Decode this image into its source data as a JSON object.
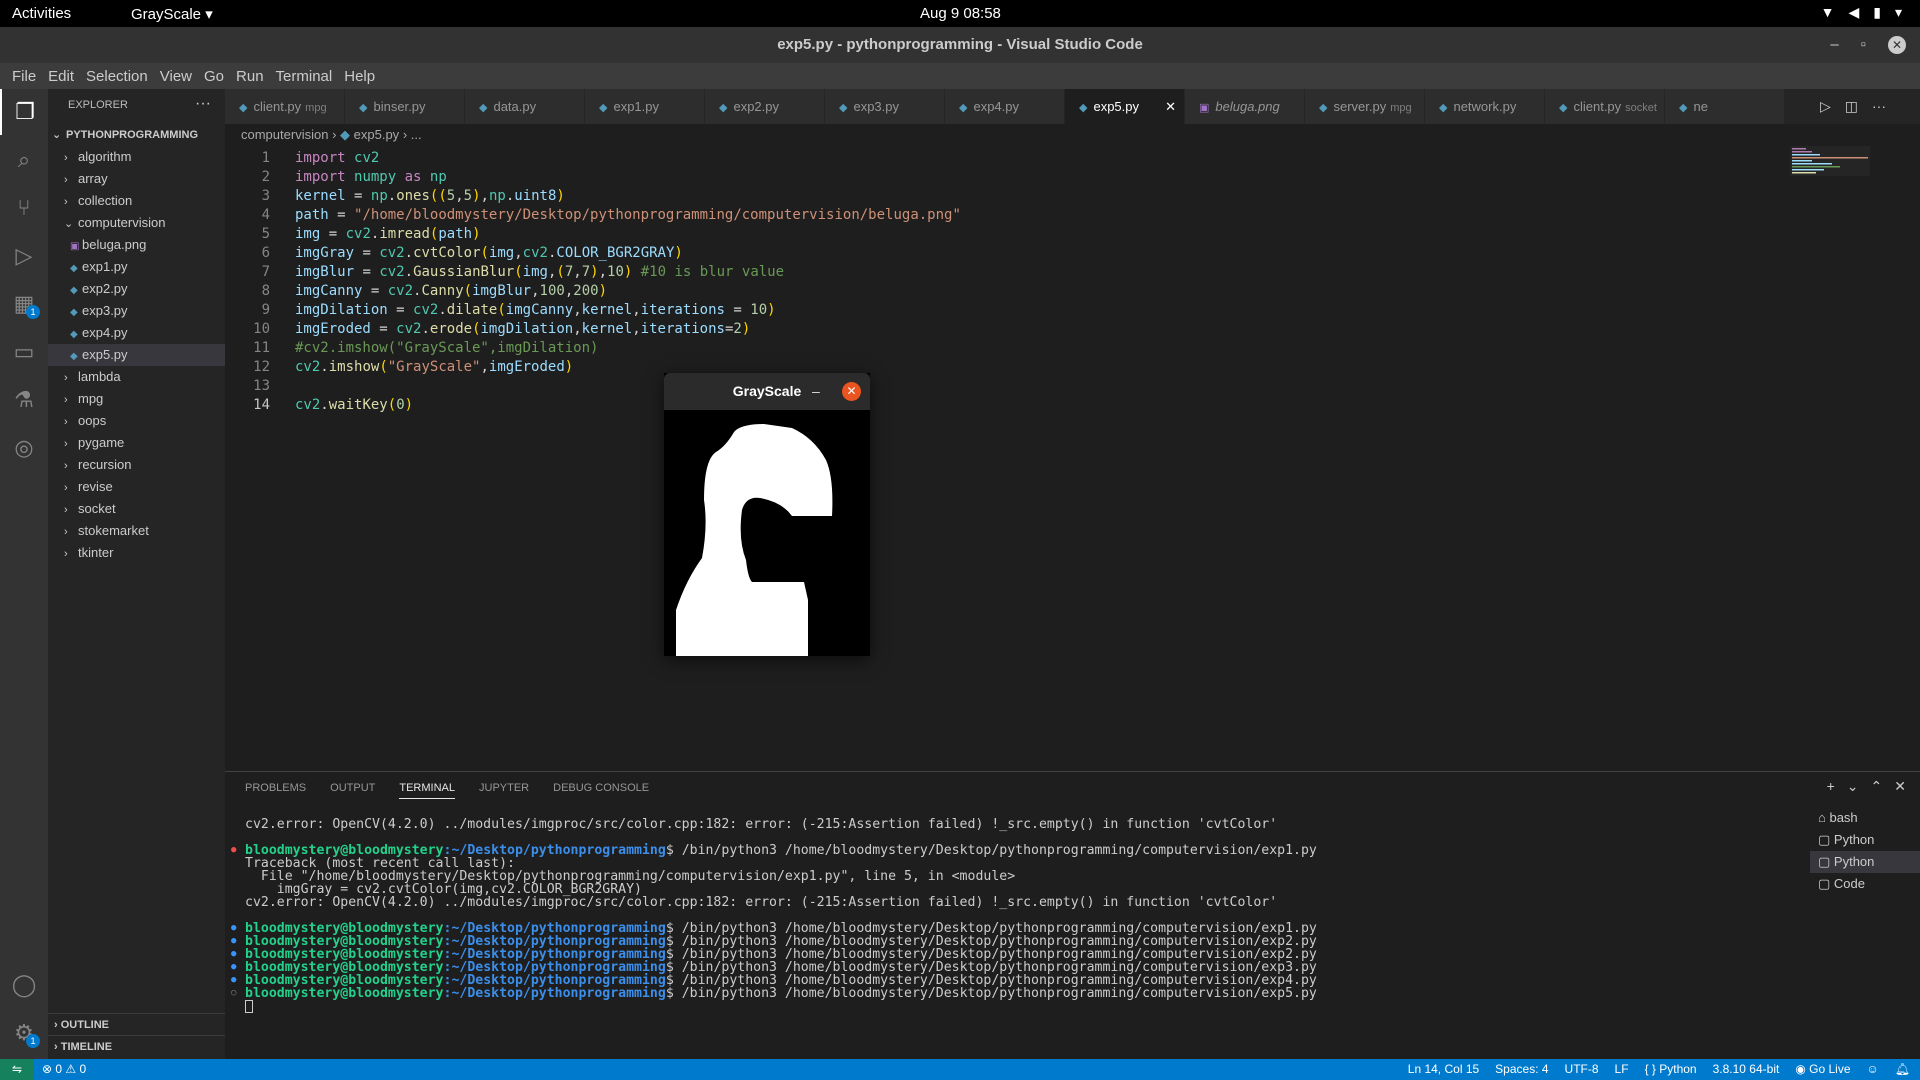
{
  "topbar": {
    "activities": "Activities",
    "app_menu": "GrayScale ▾",
    "clock": "Aug 9  08:58"
  },
  "window": {
    "title": "exp5.py - pythonprogramming - Visual Studio Code"
  },
  "menu": [
    "File",
    "Edit",
    "Selection",
    "View",
    "Go",
    "Run",
    "Terminal",
    "Help"
  ],
  "activity_bar": {
    "icons": [
      "explorer-icon",
      "search-icon",
      "source-control-icon",
      "run-debug-icon",
      "extensions-icon",
      "remote-explorer-icon",
      "testing-icon",
      "jupyter-icon",
      "account-icon",
      "settings-gear-icon"
    ],
    "extensions_badge": "1",
    "settings_badge": "1"
  },
  "explorer": {
    "header": "EXPLORER",
    "root": "PYTHONPROGRAMMING",
    "items": [
      {
        "label": "algorithm",
        "type": "folder"
      },
      {
        "label": "array",
        "type": "folder"
      },
      {
        "label": "collection",
        "type": "folder"
      },
      {
        "label": "computervision",
        "type": "folder-open"
      },
      {
        "label": "beluga.png",
        "type": "image"
      },
      {
        "label": "exp1.py",
        "type": "py"
      },
      {
        "label": "exp2.py",
        "type": "py"
      },
      {
        "label": "exp3.py",
        "type": "py"
      },
      {
        "label": "exp4.py",
        "type": "py"
      },
      {
        "label": "exp5.py",
        "type": "py",
        "selected": true
      },
      {
        "label": "lambda",
        "type": "folder"
      },
      {
        "label": "mpg",
        "type": "folder"
      },
      {
        "label": "oops",
        "type": "folder"
      },
      {
        "label": "pygame",
        "type": "folder"
      },
      {
        "label": "recursion",
        "type": "folder"
      },
      {
        "label": "revise",
        "type": "folder"
      },
      {
        "label": "socket",
        "type": "folder"
      },
      {
        "label": "stokemarket",
        "type": "folder"
      },
      {
        "label": "tkinter",
        "type": "folder"
      }
    ],
    "outline": "OUTLINE",
    "timeline": "TIMELINE"
  },
  "tabs": [
    {
      "label": "client.py",
      "desc": "mpg"
    },
    {
      "label": "binser.py",
      "desc": ""
    },
    {
      "label": "data.py",
      "desc": ""
    },
    {
      "label": "exp1.py",
      "desc": ""
    },
    {
      "label": "exp2.py",
      "desc": ""
    },
    {
      "label": "exp3.py",
      "desc": ""
    },
    {
      "label": "exp4.py",
      "desc": ""
    },
    {
      "label": "exp5.py",
      "desc": "",
      "active": true
    },
    {
      "label": "beluga.png",
      "desc": "",
      "italic": true
    },
    {
      "label": "server.py",
      "desc": "mpg"
    },
    {
      "label": "network.py",
      "desc": ""
    },
    {
      "label": "client.py",
      "desc": "socket"
    },
    {
      "label": "ne",
      "desc": ""
    }
  ],
  "breadcrumb": {
    "folder": "computervision",
    "file": "exp5.py",
    "more": "..."
  },
  "code_lines": [
    "import cv2",
    "import numpy as np",
    "kernel = np.ones((5,5),np.uint8)",
    "path = \"/home/bloodmystery/Desktop/pythonprogramming/computervision/beluga.png\"",
    "img = cv2.imread(path)",
    "imgGray = cv2.cvtColor(img,cv2.COLOR_BGR2GRAY)",
    "imgBlur = cv2.GaussianBlur(img,(7,7),10) #10 is blur value",
    "imgCanny = cv2.Canny(imgBlur,100,200)",
    "imgDilation = cv2.dilate(imgCanny,kernel,iterations = 10)",
    "imgEroded = cv2.erode(imgDilation,kernel,iterations=2)",
    "#cv2.imshow(\"GrayScale\",imgDilation)",
    "cv2.imshow(\"GrayScale\",imgEroded)",
    "",
    "cv2.waitKey(0)"
  ],
  "grayscale_window": {
    "title": "GrayScale",
    "minimize": "–",
    "close": "✕"
  },
  "panel": {
    "tabs": [
      "PROBLEMS",
      "OUTPUT",
      "TERMINAL",
      "JUPYTER",
      "DEBUG CONSOLE"
    ],
    "active_tab": "TERMINAL",
    "terminal": {
      "user": "bloodmystery@bloodmystery",
      "path": ":~/Desktop/pythonprogramming",
      "err1": "cv2.error: OpenCV(4.2.0) ../modules/imgproc/src/color.cpp:182: error: (-215:Assertion failed) !_src.empty() in function 'cvtColor'",
      "tb1": "Traceback (most recent call last):",
      "tb2": "  File \"/home/bloodmystery/Desktop/pythonprogramming/computervision/exp1.py\", line 5, in <module>",
      "tb3": "    imgGray = cv2.cvtColor(img,cv2.COLOR_BGR2GRAY)",
      "cmds": [
        "$ /bin/python3 /home/bloodmystery/Desktop/pythonprogramming/computervision/exp1.py",
        "$ /bin/python3 /home/bloodmystery/Desktop/pythonprogramming/computervision/exp1.py",
        "$ /bin/python3 /home/bloodmystery/Desktop/pythonprogramming/computervision/exp2.py",
        "$ /bin/python3 /home/bloodmystery/Desktop/pythonprogramming/computervision/exp2.py",
        "$ /bin/python3 /home/bloodmystery/Desktop/pythonprogramming/computervision/exp3.py",
        "$ /bin/python3 /home/bloodmystery/Desktop/pythonprogramming/computervision/exp4.py",
        "$ /bin/python3 /home/bloodmystery/Desktop/pythonprogramming/computervision/exp5.py"
      ]
    },
    "terminal_list": [
      "bash",
      "Python",
      "Python",
      "Code"
    ]
  },
  "statusbar": {
    "problems": "⊗ 0 ⚠ 0",
    "position": "Ln 14, Col 15",
    "spaces": "Spaces: 4",
    "encoding": "UTF-8",
    "eol": "LF",
    "language": "Python",
    "interpreter": "3.8.10 64-bit",
    "golive": "Go Live"
  }
}
